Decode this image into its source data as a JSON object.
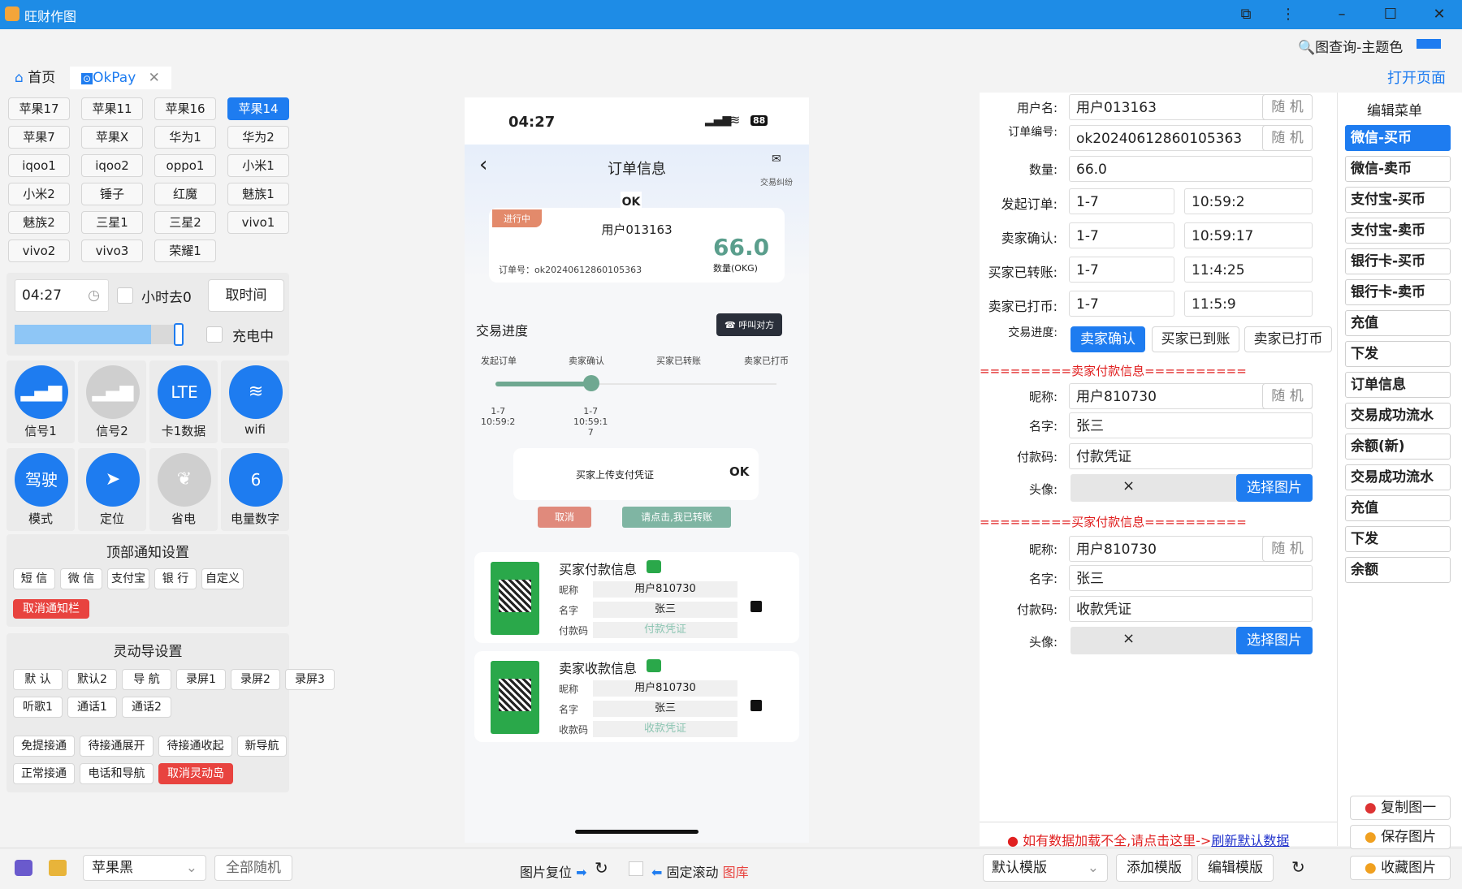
{
  "app": {
    "title": "旺财作图"
  },
  "topbar": {
    "search_label": "图查询-主题色",
    "open_page": "打开页面"
  },
  "tabs": [
    {
      "label": "首页"
    },
    {
      "label": "OkPay"
    }
  ],
  "device_buttons": [
    "苹果17",
    "苹果11",
    "苹果16",
    "苹果14",
    "苹果7",
    "苹果X",
    "华为1",
    "华为2",
    "iqoo1",
    "iqoo2",
    "oppo1",
    "小米1",
    "小米2",
    "锤子",
    "红魔",
    "魅族1",
    "魅族2",
    "三星1",
    "三星2",
    "vivo1",
    "vivo2",
    "vivo3",
    "荣耀1"
  ],
  "time_row": {
    "time": "04:27",
    "hour_minus": "小时去0",
    "get_time": "取时间",
    "charging": "充电中"
  },
  "status_icons": [
    {
      "label": "信号1",
      "icon": "signal-icon"
    },
    {
      "label": "信号2",
      "icon": "signal-icon"
    },
    {
      "label": "卡1数据",
      "icon": "LTE"
    },
    {
      "label": "wifi",
      "icon": "wifi-icon"
    },
    {
      "label": "模式",
      "icon": "驾驶"
    },
    {
      "label": "定位",
      "icon": "location-icon"
    },
    {
      "label": "省电",
      "icon": "leaf-icon"
    },
    {
      "label": "电量数字",
      "icon": "6"
    }
  ],
  "notify": {
    "title": "顶部通知设置",
    "buttons": [
      "短 信",
      "微 信",
      "支付宝",
      "银 行",
      "自定义"
    ],
    "cancel": "取消通知栏"
  },
  "island": {
    "title": "灵动导设置",
    "row1": [
      "默 认",
      "默认2",
      "导 航",
      "录屏1",
      "录屏2",
      "录屏3"
    ],
    "row2": [
      "听歌1",
      "通话1",
      "通话2"
    ],
    "row3": [
      "免提接通",
      "待接通展开",
      "待接通收起",
      "新导航"
    ],
    "row4": [
      "正常接通",
      "电话和导航"
    ],
    "cancel": "取消灵动岛"
  },
  "bottom_left": {
    "theme": "苹果黑",
    "all_random": "全部随机"
  },
  "phone": {
    "time": "04:27",
    "battery": "88",
    "header": "订单信息",
    "dispute": "交易纠纷",
    "status": "进行中",
    "username": "用户013163",
    "amount": "66.0",
    "amount_unit": "数量(OKG)",
    "order_label": "订单号：ok20240612860105363",
    "progress_title": "交易进度",
    "call": "呼叫对方",
    "steps": [
      "发起订单",
      "卖家确认",
      "买家已转账",
      "卖家已打币"
    ],
    "step1_time": "1-7\n10:59:2",
    "step2_time": "1-7\n10:59:1\n7",
    "upload": "买家上传支付凭证",
    "cancel": "取消",
    "paid": "请点击,我已转账",
    "pay_card": {
      "title": "买家付款信息",
      "rows": [
        [
          "昵称",
          "用户810730"
        ],
        [
          "名字",
          "张三"
        ],
        [
          "付款码",
          "付款凭证"
        ]
      ]
    },
    "recv_card": {
      "title": "卖家收款信息",
      "rows": [
        [
          "昵称",
          "用户810730"
        ],
        [
          "名字",
          "张三"
        ],
        [
          "收款码",
          "收款凭证"
        ]
      ]
    }
  },
  "center_bottom": {
    "reset": "图片复位",
    "fixed_scroll": "固定滚动",
    "gallery": "图库"
  },
  "form": {
    "random": "随 机",
    "username_label": "用户名:",
    "username": "用户013163",
    "order_label": "订单编号:",
    "order": "ok20240612860105363",
    "qty_label": "数量:",
    "qty": "66.0",
    "rows": [
      {
        "label": "发起订单:",
        "date": "1-7",
        "time": "10:59:2"
      },
      {
        "label": "卖家确认:",
        "date": "1-7",
        "time": "10:59:17"
      },
      {
        "label": "买家已转账:",
        "date": "1-7",
        "time": "11:4:25"
      },
      {
        "label": "卖家已打币:",
        "date": "1-7",
        "time": "11:5:9"
      }
    ],
    "progress_label": "交易进度:",
    "progress_buttons": [
      "卖家确认",
      "买家已到账",
      "卖家已打币"
    ],
    "sec1": "=========卖家付款信息==========",
    "sec2": "=========买家付款信息==========",
    "nick_label": "昵称:",
    "name_label": "名字:",
    "code_label": "付款码:",
    "avatar_label": "头像:",
    "s1_nick": "用户810730",
    "s1_name": "张三",
    "s1_code": "付款凭证",
    "s2_nick": "用户810730",
    "s2_name": "张三",
    "s2_code": "收款凭证",
    "choose": "选择图片",
    "close": "×",
    "notice": "如有数据加载不全,请点击这里->",
    "refresh": "刷新默认数据",
    "tpl_default": "默认模版",
    "tpl_add": "添加模版",
    "tpl_edit": "编辑模版"
  },
  "menu": {
    "title": "编辑菜单",
    "items": [
      "微信-买币",
      "微信-卖币",
      "支付宝-买币",
      "支付宝-卖币",
      "银行卡-买币",
      "银行卡-卖币",
      "充值",
      "下发",
      "订单信息",
      "交易成功流水",
      "余额(新)",
      "交易成功流水",
      "充值",
      "下发",
      "余额"
    ],
    "copy": "复制图一",
    "save": "保存图片",
    "collect": "收藏图片"
  }
}
